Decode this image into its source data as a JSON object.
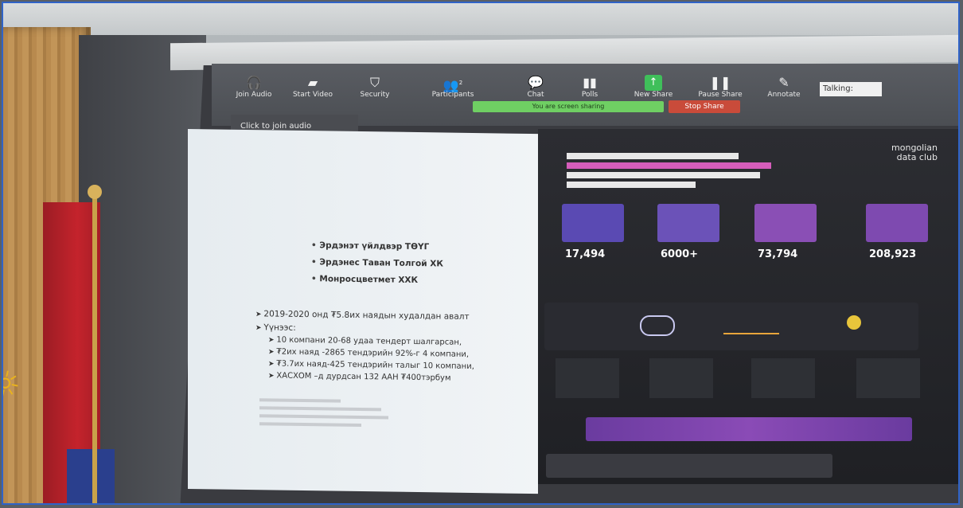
{
  "zoom_toolbar": {
    "items": [
      {
        "icon": "headphones-icon",
        "label": "Join Audio"
      },
      {
        "icon": "video-off-icon",
        "label": "Start Video"
      },
      {
        "icon": "shield-icon",
        "label": "Security"
      },
      {
        "icon": "participants-icon",
        "label": "Participants",
        "count": "2"
      },
      {
        "icon": "chat-icon",
        "label": "Chat"
      },
      {
        "icon": "polls-icon",
        "label": "Polls"
      },
      {
        "icon": "new-share-icon",
        "label": "New Share"
      },
      {
        "icon": "pause-icon",
        "label": "Pause Share"
      },
      {
        "icon": "annotate-icon",
        "label": "Annotate"
      }
    ],
    "share_banner": "You are screen sharing",
    "stop_share": "Stop Share",
    "talking": "Talking:",
    "join_audio_tip": "Click to join audio"
  },
  "left_slide": {
    "bullets": [
      "Эрдэнэт үйлдвэр ТӨҮГ",
      "Эрдэнес Таван Толгой ХК",
      "Монросцветмет ХХК"
    ],
    "lines": [
      "2019-2020 онд ₮5.8их наядын худалдан авалт",
      "Үүнээс:"
    ],
    "sub_lines": [
      "10 компани 20-68 удаа тендерт шалгарсан,",
      "₮2их наяд -2865 тендэрийн 92%-г 4 компани,",
      "₮3.7их наяд-425 тендэрийн талыг 10 компани,",
      "ХАСХОМ –д дурдсан 132 ААН ₮400тэрбум"
    ]
  },
  "right_slide": {
    "brand_line1": "mongolian",
    "brand_line2": "data club",
    "stats": [
      "17,494",
      "6000+",
      "73,794",
      "208,923"
    ]
  },
  "colors": {
    "flag_red": "#c4232c",
    "flag_blue": "#2a3f8d",
    "flag_gold": "#e9b21d",
    "zoom_green": "#49d16a",
    "stop_red": "#c94b3a"
  }
}
